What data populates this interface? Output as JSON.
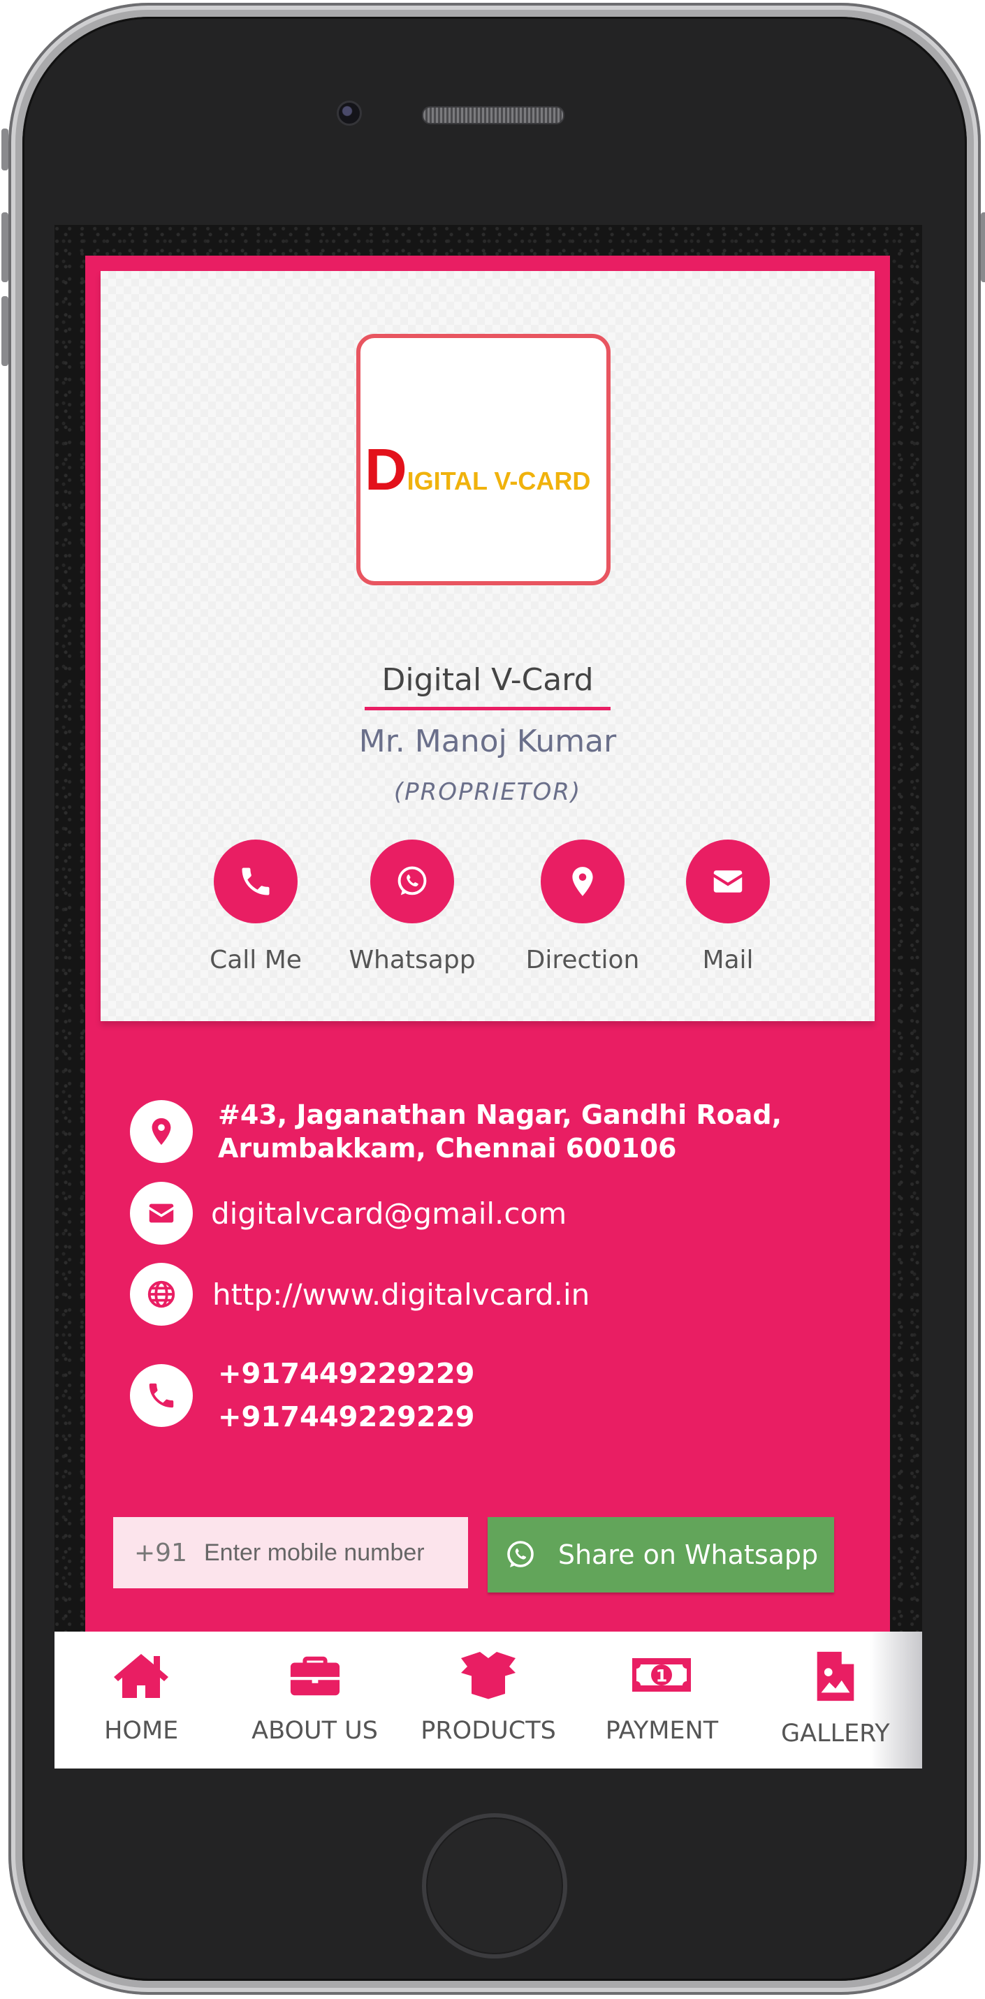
{
  "brand": {
    "logo_initial": "D",
    "logo_rest": "IGITAL V-CARD",
    "company_name": "Digital V-Card",
    "person_name": "Mr. Manoj Kumar",
    "designation": "(PROPRIETOR)"
  },
  "actions": [
    {
      "label": "Call Me",
      "icon": "phone-icon"
    },
    {
      "label": "Whatsapp",
      "icon": "whatsapp-icon"
    },
    {
      "label": "Direction",
      "icon": "map-pin-icon"
    },
    {
      "label": "Mail",
      "icon": "envelope-icon"
    }
  ],
  "contact": {
    "address_line1": "#43, Jaganathan Nagar, Gandhi Road,",
    "address_line2": "Arumbakkam, Chennai 600106",
    "email": "digitalvcard@gmail.com",
    "website": "http://www.digitalvcard.in",
    "phone1": "+917449229229",
    "phone2": "+917449229229"
  },
  "share": {
    "country_code": "+91",
    "placeholder": "Enter mobile number",
    "button_label": "Share on Whatsapp"
  },
  "nav": [
    {
      "label": "HOME",
      "icon": "home-icon"
    },
    {
      "label": "ABOUT US",
      "icon": "briefcase-icon"
    },
    {
      "label": "PRODUCTS",
      "icon": "open-box-icon"
    },
    {
      "label": "PAYMENT",
      "icon": "money-icon"
    },
    {
      "label": "GALLERY",
      "icon": "image-file-icon"
    }
  ],
  "colors": {
    "accent": "#e91e63",
    "whatsapp_green": "#62a55a",
    "input_bg": "#fce4ec"
  }
}
